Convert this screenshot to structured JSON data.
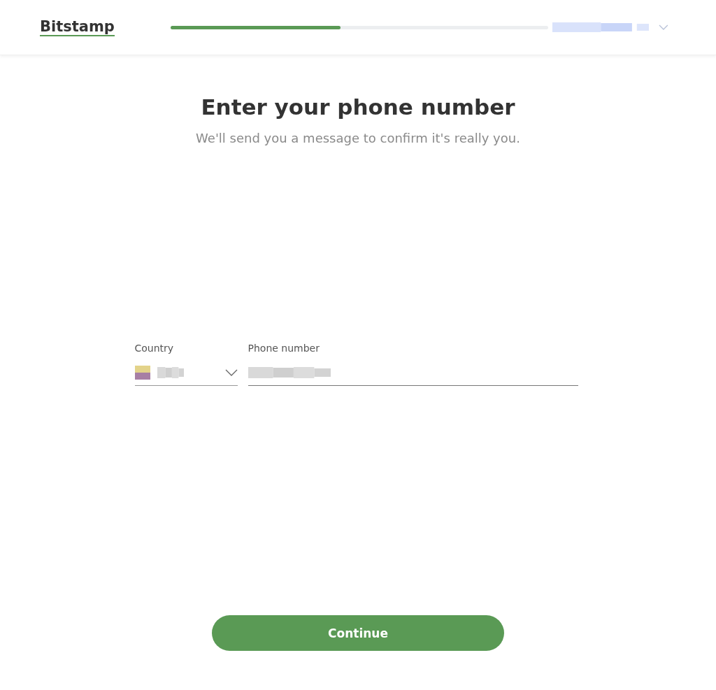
{
  "header": {
    "logo": "Bitstamp",
    "progress": {
      "level": 0.45
    }
  },
  "title": "Enter your phone number",
  "subtitle": "We'll send you a message to confirm it's really you.",
  "fields": [
    {
      "kind": "select",
      "label": "Country"
    },
    {
      "kind": "text",
      "label": "Phone number"
    }
  ],
  "buttons": [
    {
      "label": "Continue"
    }
  ]
}
